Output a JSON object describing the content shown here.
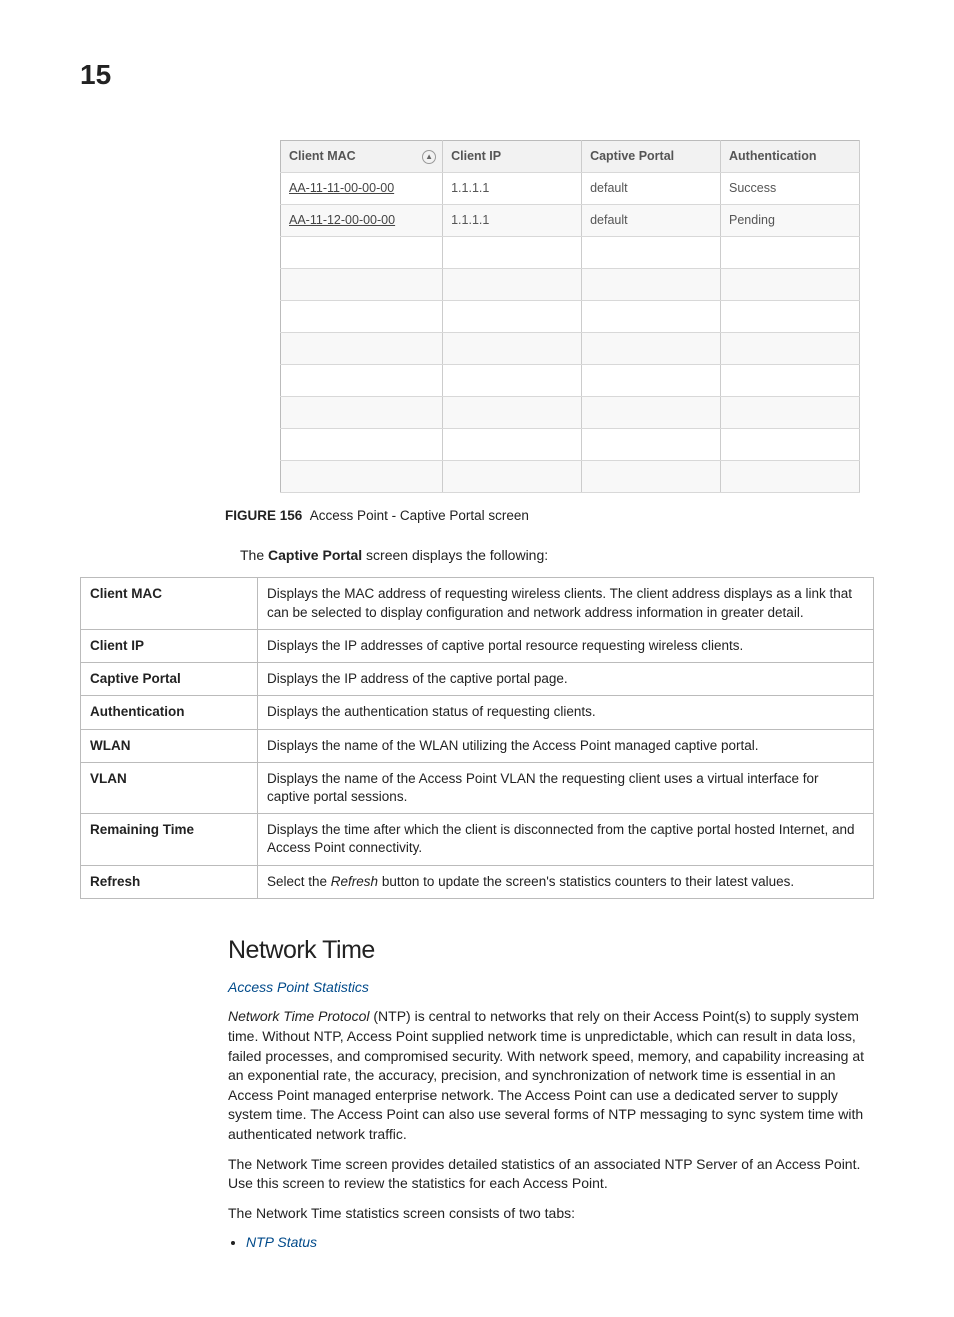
{
  "page_number": "15",
  "captive_portal_table": {
    "headers": [
      "Client MAC",
      "Client IP",
      "Captive Portal",
      "Authentication"
    ],
    "rows": [
      {
        "mac": "AA-11-11-00-00-00",
        "ip": "1.1.1.1",
        "cp": "default",
        "auth": "Success"
      },
      {
        "mac": "AA-11-12-00-00-00",
        "ip": "1.1.1.1",
        "cp": "default",
        "auth": "Pending"
      }
    ],
    "empty_rows": 8
  },
  "figure": {
    "label": "FIGURE 156",
    "caption": "Access Point - Captive Portal screen"
  },
  "intro": {
    "prefix": "The ",
    "bold": "Captive Portal",
    "suffix": " screen displays the following:"
  },
  "desc": [
    {
      "term": "Client MAC",
      "def": "Displays the MAC address of requesting wireless clients. The client address displays as a link that can be selected to display configuration and network address information in greater detail."
    },
    {
      "term": "Client IP",
      "def": "Displays the IP addresses of captive portal resource requesting wireless clients."
    },
    {
      "term": "Captive Portal",
      "def": "Displays the IP address of the captive portal page."
    },
    {
      "term": "Authentication",
      "def": "Displays the authentication status of requesting clients."
    },
    {
      "term": "WLAN",
      "def": "Displays the name of the WLAN utilizing the Access Point managed captive portal."
    },
    {
      "term": "VLAN",
      "def": "Displays the name of the Access Point VLAN the requesting client uses a virtual interface for captive portal sessions."
    },
    {
      "term": "Remaining Time",
      "def": "Displays the time after which the client is disconnected from the captive portal hosted Internet, and Access Point connectivity."
    },
    {
      "term": "Refresh",
      "def_prefix": "Select the ",
      "def_italic": "Refresh",
      "def_suffix": " button to update the screen's statistics counters to their latest values."
    }
  ],
  "section": {
    "heading": "Network Time",
    "subhead_link": "Access Point Statistics",
    "para1_italic": "Network Time Protocol",
    "para1_rest": " (NTP) is central to networks that rely on their Access Point(s) to supply system time. Without NTP, Access Point supplied network time is unpredictable, which can result in data loss, failed processes, and compromised security. With network speed, memory, and capability increasing at an exponential rate, the accuracy, precision, and synchronization of network time is essential in an Access Point managed enterprise network. The Access Point can use a dedicated server to supply system time. The Access Point can also use several forms of NTP messaging to sync system time with authenticated network traffic.",
    "para2": "The Network Time screen provides detailed statistics of an associated NTP Server of an Access Point. Use this screen to review the statistics for each Access Point.",
    "para3": "The Network Time statistics screen consists of two tabs:",
    "bullets": [
      "NTP Status"
    ]
  }
}
